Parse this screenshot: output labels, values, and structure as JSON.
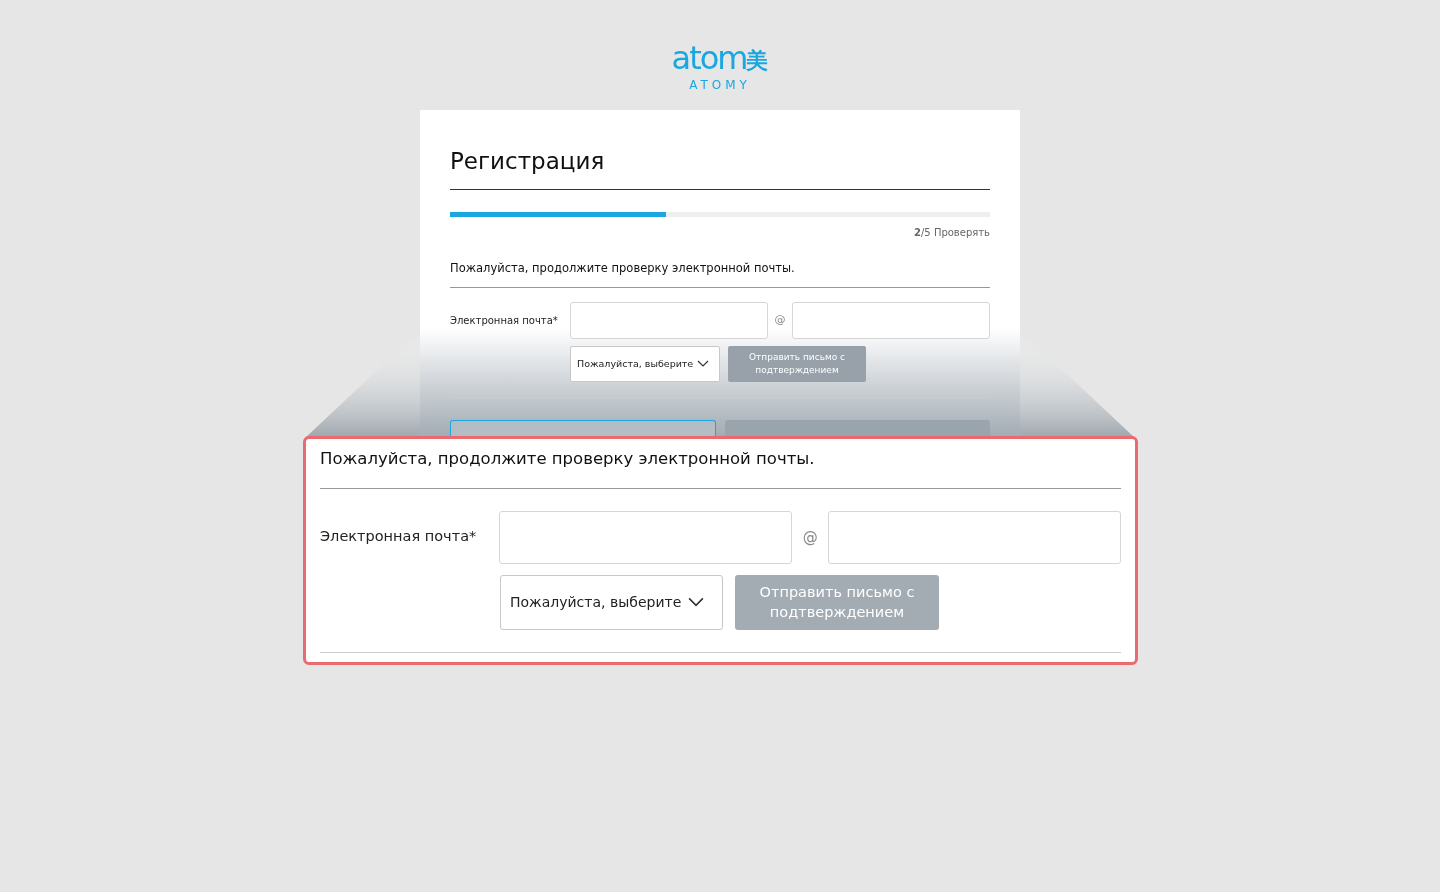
{
  "logo": {
    "wordmark": "atom",
    "hanja": "美",
    "subtitle": "ATOMY"
  },
  "card": {
    "title": "Регистрация",
    "progress": {
      "level": 0.4
    },
    "step": "**2**/5 Проверять",
    "form": {
      "heading": "Пожалуйста, продолжите проверку электронной почты.",
      "email_label": "Электронная почта*",
      "at_sign": "@",
      "domain_select": "Пожалуйста, выберите",
      "send_button": {
        "label": "Отправить письмо с подтверждением",
        "disabled": true
      }
    }
  },
  "zoom_callout": {
    "form": {
      "heading": "Пожалуйста, продолжите проверку электронной почты.",
      "email_label": "Электронная почта*",
      "at_sign": "@",
      "domain_select": "Пожалуйста, выберите",
      "send_button": {
        "label": "Отправить письмо с подтверждением",
        "disabled": true
      }
    }
  }
}
